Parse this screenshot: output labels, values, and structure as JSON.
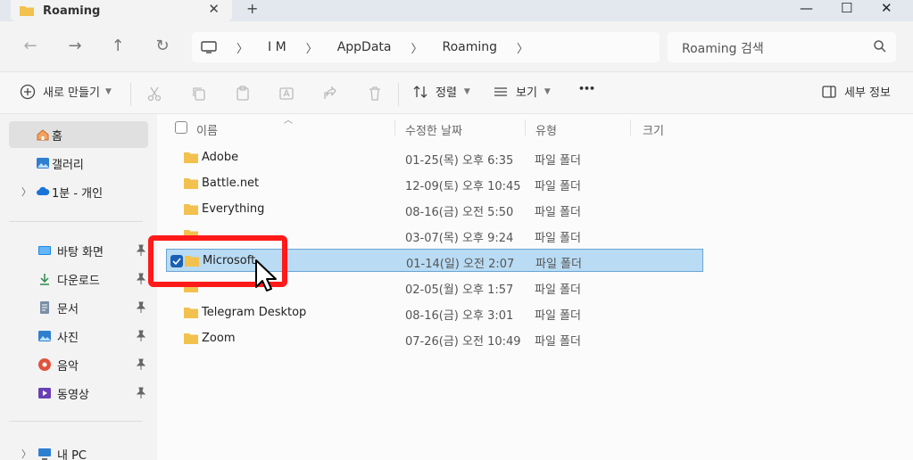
{
  "colors": {
    "accent": "#1a5fb4",
    "selection": "#b9dbf3",
    "highlight": "#ff1a1a",
    "folder": "#f2c14e"
  },
  "window": {
    "tab_title": "Roaming",
    "close_glyph": "✕",
    "new_tab_glyph": "+"
  },
  "window_controls": {
    "minimize": "—",
    "maximize": "☐",
    "close": "✕"
  },
  "nav": {
    "back": "←",
    "forward": "→",
    "up": "↑",
    "refresh": "↻"
  },
  "breadcrumb": [
    "I M",
    "AppData",
    "Roaming"
  ],
  "search": {
    "placeholder": "Roaming 검색"
  },
  "toolbar": {
    "new_label": "새로 만들기",
    "sort_label": "정렬",
    "view_label": "보기",
    "more_label": "•••",
    "details_label": "세부 정보"
  },
  "sidebar": {
    "home": "홈",
    "gallery": "갤러리",
    "onedrive": "1분 - 개인",
    "quick": [
      {
        "label": "바탕 화면",
        "icon": "desktop-icon"
      },
      {
        "label": "다운로드",
        "icon": "download-icon"
      },
      {
        "label": "문서",
        "icon": "document-icon"
      },
      {
        "label": "사진",
        "icon": "pictures-icon"
      },
      {
        "label": "음악",
        "icon": "music-icon"
      },
      {
        "label": "동영상",
        "icon": "video-icon"
      }
    ],
    "this_pc": "내 PC"
  },
  "columns": {
    "name": "이름",
    "date": "수정한 날짜",
    "type": "유형",
    "size": "크기"
  },
  "files": [
    {
      "name": "Adobe",
      "date": "01-25(목) 오후 6:35",
      "type": "파일 폴더"
    },
    {
      "name": "Battle.net",
      "date": "12-09(토) 오후 10:45",
      "type": "파일 폴더"
    },
    {
      "name": "Everything",
      "date": "08-16(금) 오전 5:50",
      "type": "파일 폴더"
    },
    {
      "name": "",
      "date": "03-07(목) 오후 9:24",
      "type": "파일 폴더"
    },
    {
      "name": "Microsoft",
      "date": "01-14(일) 오전 2:07",
      "type": "파일 폴더",
      "selected": true
    },
    {
      "name": "",
      "date": "02-05(월) 오후 1:57",
      "type": "파일 폴더"
    },
    {
      "name": "Telegram Desktop",
      "date": "08-16(금) 오후 3:01",
      "type": "파일 폴더"
    },
    {
      "name": "Zoom",
      "date": "07-26(금) 오전 10:49",
      "type": "파일 폴더"
    }
  ]
}
